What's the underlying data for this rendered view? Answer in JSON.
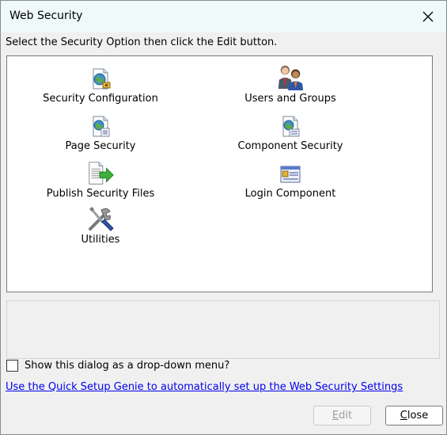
{
  "window": {
    "title": "Web Security"
  },
  "instruction": "Select the Security Option then click the Edit button.",
  "options": [
    {
      "label": "Security Configuration",
      "icon": "security-configuration-icon"
    },
    {
      "label": "Users and Groups",
      "icon": "users-groups-icon"
    },
    {
      "label": "Page Security",
      "icon": "page-security-icon"
    },
    {
      "label": "Component Security",
      "icon": "component-security-icon"
    },
    {
      "label": "Publish Security Files",
      "icon": "publish-files-icon"
    },
    {
      "label": "Login Component",
      "icon": "login-component-icon"
    },
    {
      "label": "Utilities",
      "icon": "utilities-icon"
    }
  ],
  "checkbox": {
    "label": "Show this dialog as a drop-down menu?",
    "checked": false
  },
  "link": "Use the Quick Setup Genie to automatically set up the Web Security Settings",
  "buttons": {
    "edit": {
      "label_first": "E",
      "label_rest": "dit",
      "enabled": false
    },
    "close": {
      "label_first": "C",
      "label_rest": "lose",
      "enabled": true
    }
  }
}
